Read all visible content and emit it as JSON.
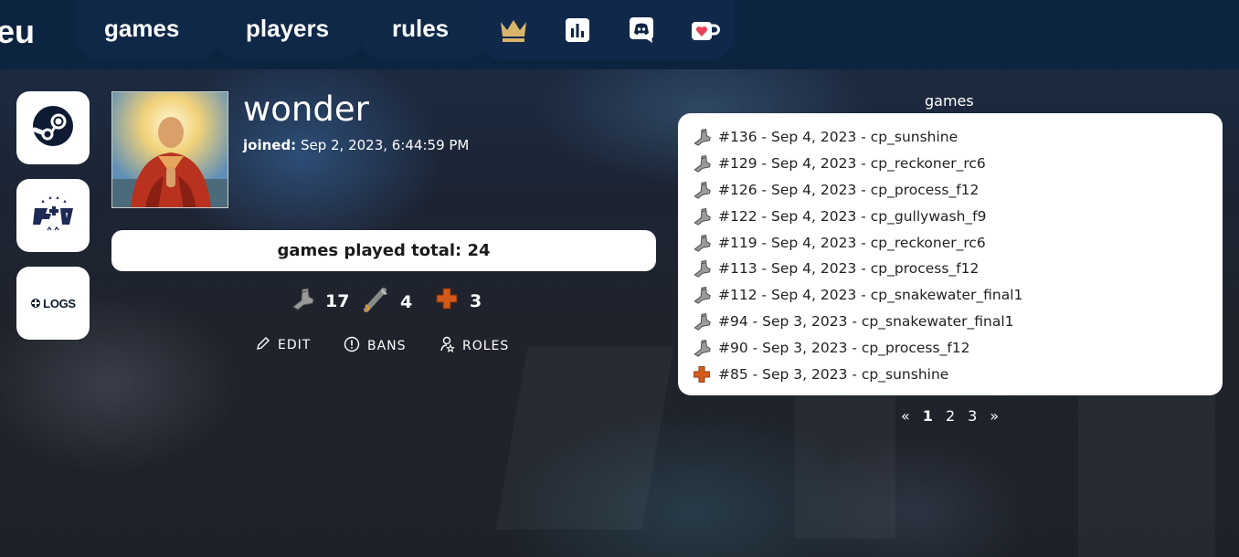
{
  "nav": {
    "brand": "eu",
    "links": [
      "games",
      "players",
      "rules"
    ],
    "icons": [
      "crown-icon",
      "stats-icon",
      "discord-icon",
      "coffee-icon"
    ]
  },
  "side_links": [
    "steam-icon",
    "etf2l-icon",
    "logs-icon"
  ],
  "side_logs_text": "LOGS",
  "profile": {
    "username": "wonder",
    "joined_label": "joined:",
    "joined_value": "Sep 2, 2023, 6:44:59 PM",
    "games_total_label": "games played total: 24",
    "class_stats": [
      {
        "icon": "scout-icon",
        "count": "17"
      },
      {
        "icon": "soldier-icon",
        "count": "4"
      },
      {
        "icon": "medic-icon",
        "count": "3"
      }
    ],
    "actions": [
      "EDIT",
      "BANS",
      "ROLES"
    ]
  },
  "games": {
    "title": "games",
    "rows": [
      {
        "icon": "scout-icon",
        "text": "#136 - Sep 4, 2023 - cp_sunshine"
      },
      {
        "icon": "scout-icon",
        "text": "#129 - Sep 4, 2023 - cp_reckoner_rc6"
      },
      {
        "icon": "scout-icon",
        "text": "#126 - Sep 4, 2023 - cp_process_f12"
      },
      {
        "icon": "scout-icon",
        "text": "#122 - Sep 4, 2023 - cp_gullywash_f9"
      },
      {
        "icon": "scout-icon",
        "text": "#119 - Sep 4, 2023 - cp_reckoner_rc6"
      },
      {
        "icon": "scout-icon",
        "text": "#113 - Sep 4, 2023 - cp_process_f12"
      },
      {
        "icon": "scout-icon",
        "text": "#112 - Sep 4, 2023 - cp_snakewater_final1"
      },
      {
        "icon": "scout-icon",
        "text": "#94 - Sep 3, 2023 - cp_snakewater_final1"
      },
      {
        "icon": "scout-icon",
        "text": "#90 - Sep 3, 2023 - cp_process_f12"
      },
      {
        "icon": "medic-icon",
        "text": "#85 - Sep 3, 2023 - cp_sunshine"
      }
    ],
    "pager": {
      "prev": "«",
      "pages": [
        "1",
        "2",
        "3"
      ],
      "current": "1",
      "next": "»"
    }
  },
  "colors": {
    "nav": "#0d2441",
    "card": "#ffffff",
    "crown": "#d8b46a",
    "medic": "#d35a1a"
  }
}
